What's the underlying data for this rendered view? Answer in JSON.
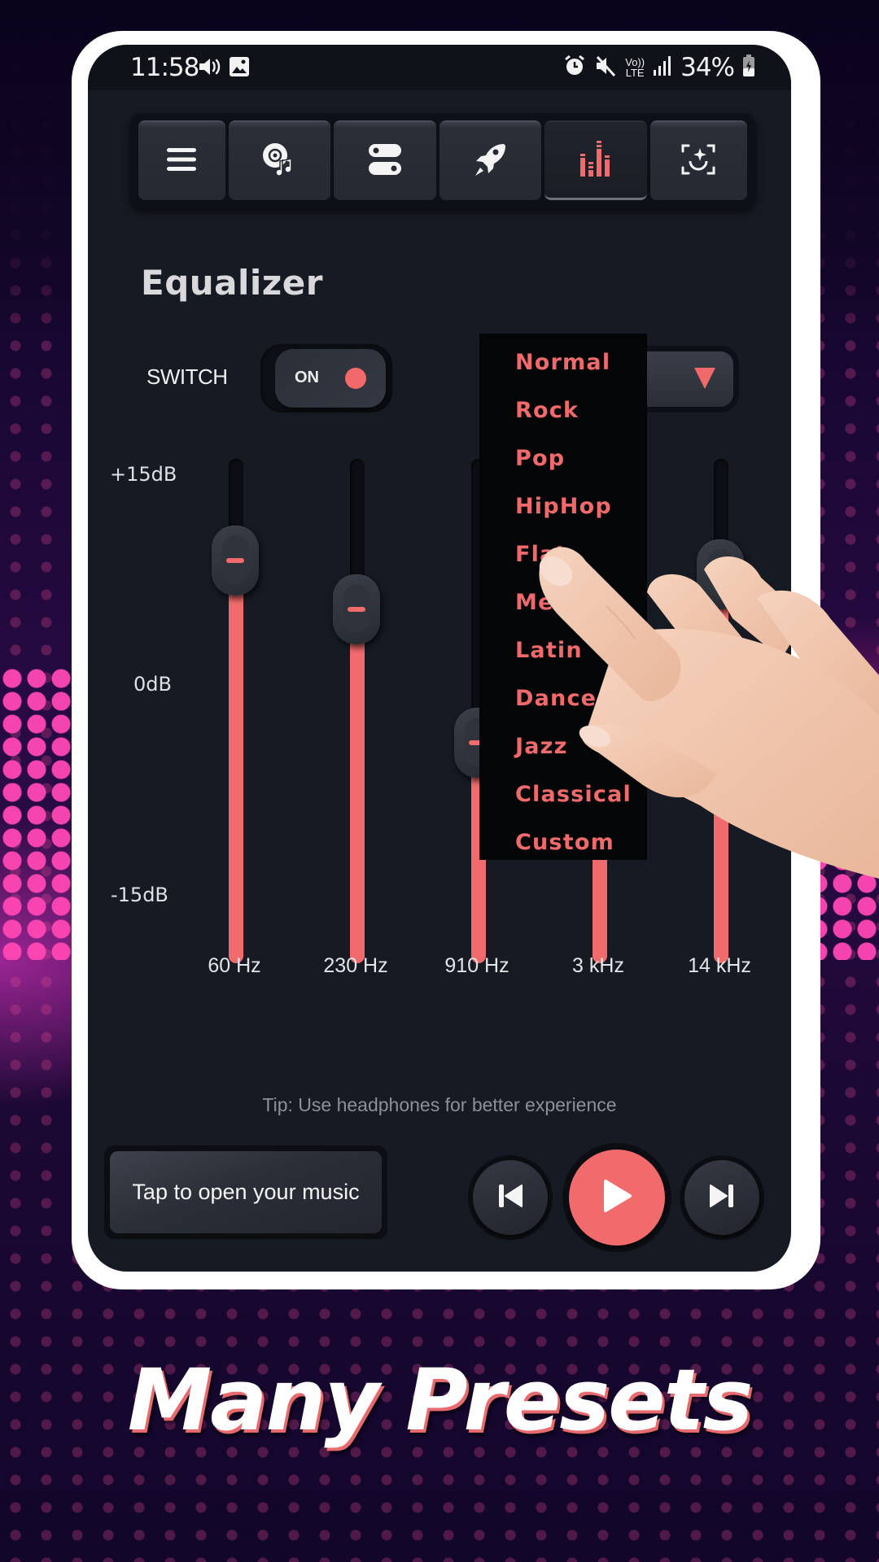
{
  "status_bar": {
    "time": "11:58",
    "battery_percent": "34%",
    "network_label_top": "Vo))",
    "network_label_bottom": "LTE",
    "left_icons": [
      "volume-icon",
      "gallery-icon"
    ],
    "right_icons": [
      "alarm-icon",
      "mute-icon",
      "volte-icon",
      "signal-icon",
      "battery-charging-icon"
    ]
  },
  "tabs": [
    {
      "name": "menu",
      "icon": "menu-icon",
      "active": false
    },
    {
      "name": "music",
      "icon": "music-disc-icon",
      "active": false
    },
    {
      "name": "toggles",
      "icon": "toggles-icon",
      "active": false
    },
    {
      "name": "boost",
      "icon": "rocket-icon",
      "active": false
    },
    {
      "name": "equalizer",
      "icon": "equalizer-icon",
      "active": true
    },
    {
      "name": "effects",
      "icon": "sparkle-frame-icon",
      "active": false
    }
  ],
  "equalizer": {
    "title": "Equalizer",
    "switch_label": "SWITCH",
    "switch_state": "ON",
    "db_labels": {
      "max": "+15dB",
      "mid": "0dB",
      "min": "-15dB"
    },
    "db_range": [
      -15,
      15
    ],
    "bands": [
      {
        "label": "60 Hz",
        "gain_db": 9
      },
      {
        "label": "230 Hz",
        "gain_db": 5.5
      },
      {
        "label": "910 Hz",
        "gain_db": -4
      },
      {
        "label": "3 kHz",
        "gain_db": -5
      },
      {
        "label": "14 kHz",
        "gain_db": 8
      }
    ]
  },
  "preset_menu": {
    "open": true,
    "items": [
      "Normal",
      "Rock",
      "Pop",
      "HipHop",
      "Flat",
      "Metal",
      "Latin",
      "Dance",
      "Jazz",
      "Classical",
      "Custom"
    ]
  },
  "tip": "Tip: Use headphones for better experience",
  "player": {
    "open_music_label": "Tap to open your music",
    "prev_icon": "skip-previous-icon",
    "play_icon": "play-icon",
    "next_icon": "skip-next-icon"
  },
  "banner": "Many Presets",
  "colors": {
    "accent": "#f26b6c",
    "screen_bg": "#161a23",
    "menu_bg": "#040507",
    "frame": "#ffffff"
  }
}
